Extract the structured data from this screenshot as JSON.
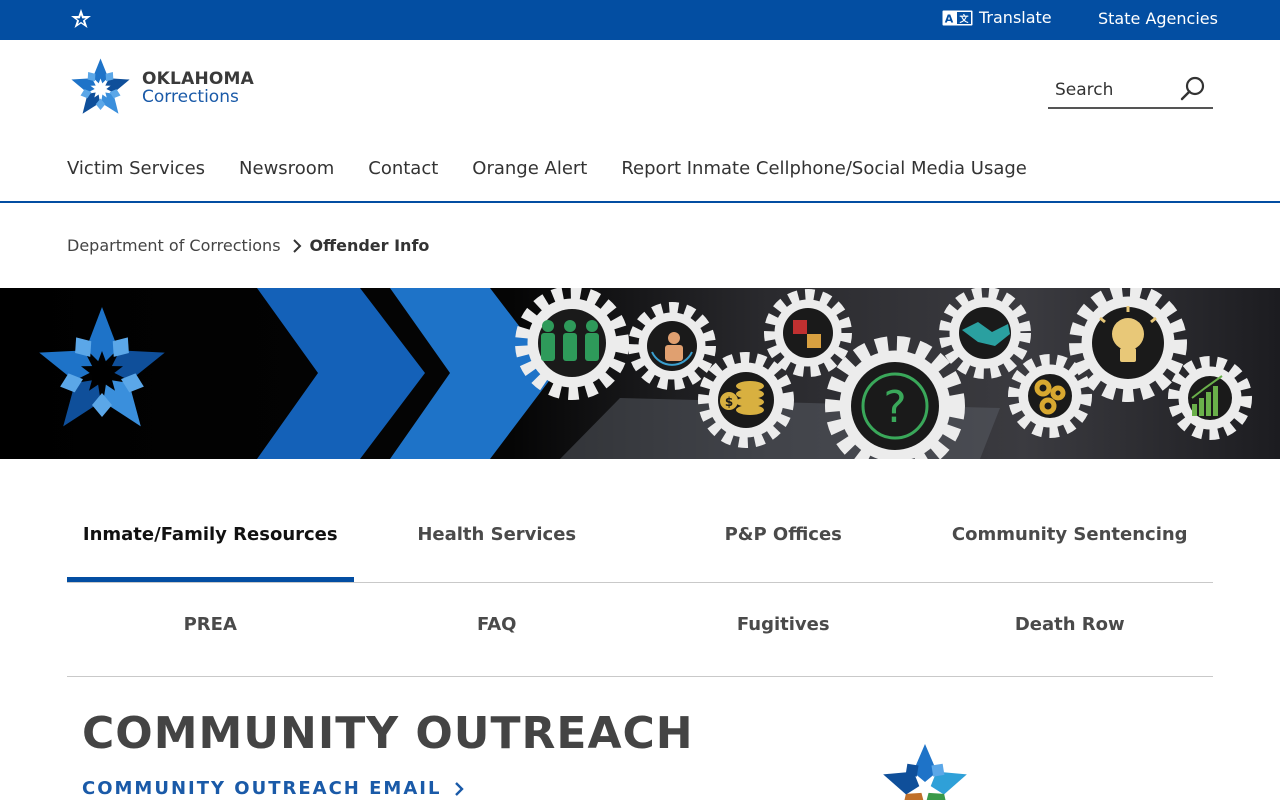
{
  "topbar": {
    "translate_label": "Translate",
    "agencies_label": "State Agencies",
    "star_icon": "oklahoma-star-icon",
    "translate_icon": "translate-icon"
  },
  "header": {
    "logo_line1": "OKLAHOMA",
    "logo_line2": "Corrections",
    "search_placeholder": "Search"
  },
  "nav": {
    "items": [
      "Victim Services",
      "Newsroom",
      "Contact",
      "Orange Alert",
      "Report Inmate Cellphone/Social Media Usage"
    ]
  },
  "breadcrumb": {
    "parent": "Department of Corrections",
    "current": "Offender Info"
  },
  "tabs": {
    "row1": [
      "Inmate/Family Resources",
      "Health Services",
      "P&P Offices",
      "Community Sentencing"
    ],
    "row2": [
      "PREA",
      "FAQ",
      "Fugitives",
      "Death Row"
    ],
    "active": "Inmate/Family Resources"
  },
  "content": {
    "title": "COMMUNITY OUTREACH",
    "email_link": "COMMUNITY OUTREACH EMAIL"
  },
  "colors": {
    "brand_blue": "#034ea2",
    "link_blue": "#1a5aa8"
  }
}
